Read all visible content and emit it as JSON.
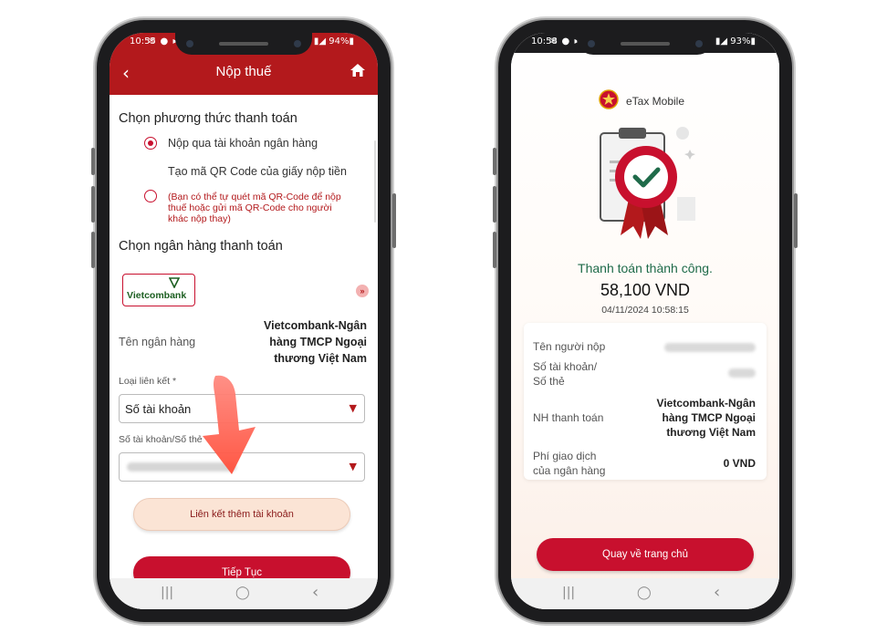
{
  "left_phone": {
    "status": {
      "time": "10:55",
      "icons": "✉ ● ▸",
      "battery": "▮◢ 94%▮"
    },
    "appbar": {
      "back_icon": "chevron-left-icon",
      "title": "Nộp thuế",
      "home_icon": "home-icon"
    },
    "payment_method": {
      "heading": "Chọn phương thức thanh toán",
      "options": [
        {
          "label": "Nộp qua tài khoản ngân hàng",
          "selected": true
        },
        {
          "label": "Tạo mã QR Code của giấy nộp tiền",
          "selected": false,
          "note": "(Bạn có thể tự quét mã QR-Code để nộp thuế hoặc gửi mã QR-Code cho người khác nộp thay)"
        }
      ]
    },
    "bank": {
      "heading": "Chọn ngân hàng thanh toán",
      "logo_text": "Vietcombank",
      "scroll_glyph": "»",
      "name_label": "Tên ngân hàng",
      "name_value": "Vietcombank-Ngân hàng TMCP Ngoại thương Việt Nam"
    },
    "link_type": {
      "label": "Loại liên kết *",
      "value": "Số tài khoản"
    },
    "account": {
      "label": "Số tài khoản/Số thẻ"
    },
    "buttons": {
      "link_more": "Liên kết thêm tài khoản",
      "continue": "Tiếp Tục"
    },
    "nav": {
      "recent": "|||",
      "home": "◯",
      "back": "‹"
    }
  },
  "right_phone": {
    "status": {
      "time": "10:58",
      "icons": "✉ ● ▸",
      "battery": "▮◢ 93%▮"
    },
    "brand": "eTax Mobile",
    "success_text": "Thanh toán thành công.",
    "amount": "58,100 VND",
    "timestamp": "04/11/2024 10:58:15",
    "details": {
      "payer_label": "Tên người nộp",
      "account_label_1": "Số tài khoản/",
      "account_label_2": "Số thẻ",
      "bank_label": "NH thanh toán",
      "bank_value": "Vietcombank-Ngân hàng TMCP Ngoại thương Việt Nam",
      "fee_label_1": "Phí giao dịch",
      "fee_label_2": "của ngân hàng",
      "fee_value": "0 VND"
    },
    "button_home": "Quay về trang chủ",
    "nav": {
      "recent": "|||",
      "home": "◯",
      "back": "‹"
    }
  },
  "colors": {
    "brand_red": "#b3191c",
    "success_green": "#1f6b4a",
    "soft_button": "#fbe4d5"
  }
}
